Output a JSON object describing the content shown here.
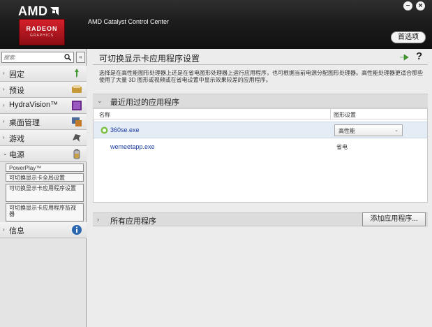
{
  "header": {
    "brand": "AMD",
    "badge_line1": "RADEON",
    "badge_line2": "GRAPHICS",
    "app_title": "AMD Catalyst Control Center",
    "preferences_label": "首选项",
    "minimize_glyph": "−",
    "close_glyph": "×"
  },
  "sidebar": {
    "search_placeholder": "搜索",
    "collapse_glyph": "«",
    "items": [
      {
        "label": "固定",
        "chevron": "›",
        "icon": "pin-icon"
      },
      {
        "label": "预设",
        "chevron": "›",
        "icon": "presets-icon"
      },
      {
        "label": "HydraVision™",
        "chevron": "›",
        "icon": "hydravision-icon"
      },
      {
        "label": "桌面管理",
        "chevron": "›",
        "icon": "desktop-management-icon"
      },
      {
        "label": "游戏",
        "chevron": "›",
        "icon": "gaming-icon"
      },
      {
        "label": "电源",
        "chevron": "⌄",
        "icon": "power-icon"
      },
      {
        "label": "信息",
        "chevron": "›",
        "icon": "info-icon"
      }
    ],
    "power_subitems": [
      "PowerPlay™",
      "可切换显示卡全局设置",
      "可切换显示卡应用程序设置",
      "可切换显示卡应用程序监视器"
    ]
  },
  "main": {
    "title": "可切换显示卡应用程序设置",
    "help_glyph": "?",
    "description": "选择是在高性能图形处理器上还是在省电图形处理器上运行应用程序，也可根据当前电源分配图形处理器。高性能处理器更适合那些使用了大量 3D 图形或视频或在省电设置中显示效果较差的应用程序。",
    "recent_section_label": "最近用过的应用程序",
    "table": {
      "col_name": "名称",
      "col_graphics": "图形设置",
      "rows": [
        {
          "name": "360se.exe",
          "setting": "高性能",
          "selected": true
        },
        {
          "name": "wemeetapp.exe",
          "setting": "省电",
          "selected": false
        }
      ]
    },
    "all_apps_section_label": "所有应用程序",
    "add_app_label": "添加应用程序..."
  },
  "colors": {
    "accent_red": "#d5202b",
    "link_blue": "#1a3c9c",
    "selection": "#e4ecf6"
  }
}
